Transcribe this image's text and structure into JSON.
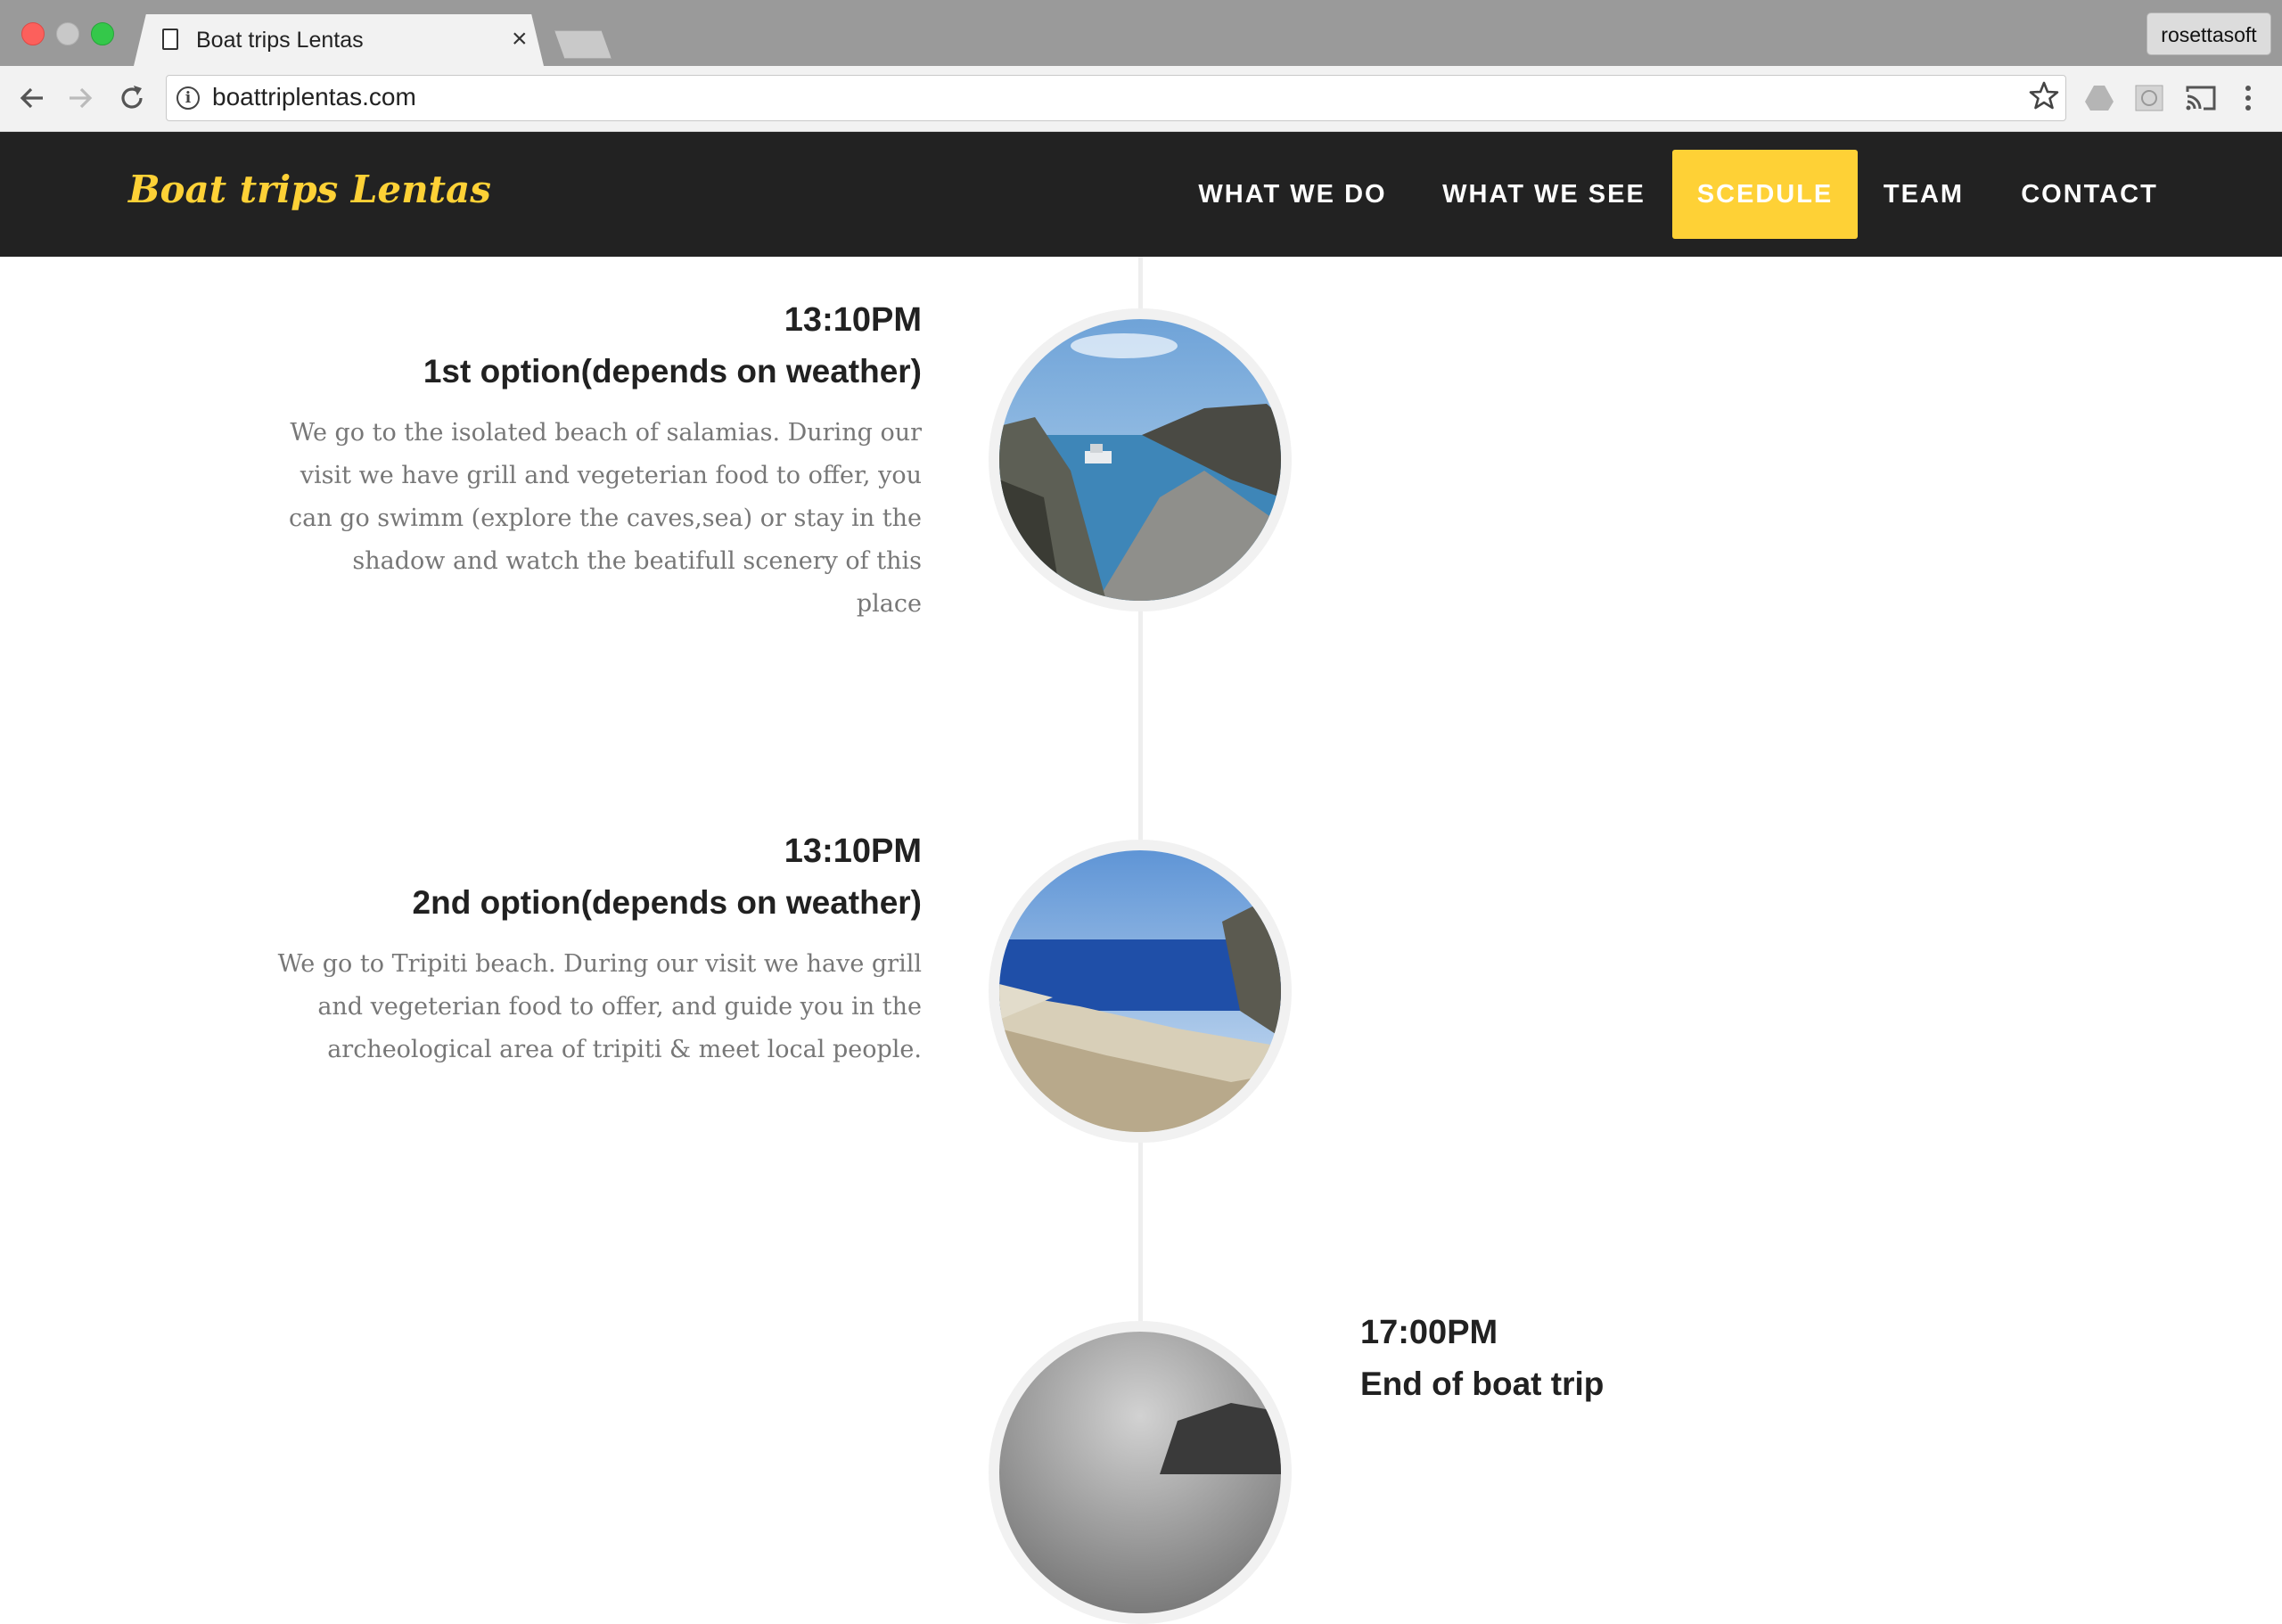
{
  "browser": {
    "tab_title": "Boat trips Lentas",
    "tab_close": "×",
    "profile_name": "rosettasoft",
    "url": "boattriplentas.com",
    "info_glyph": "i"
  },
  "site": {
    "brand": "Boat trips Lentas",
    "nav": [
      {
        "label": "WHAT WE DO",
        "active": false
      },
      {
        "label": "WHAT WE SEE",
        "active": false
      },
      {
        "label": "SCEDULE",
        "active": true
      },
      {
        "label": "TEAM",
        "active": false
      },
      {
        "label": "CONTACT",
        "active": false
      }
    ],
    "accent_color": "#fed136"
  },
  "timeline": [
    {
      "time": "13:10PM",
      "title": "1st option(depends on weather)",
      "lines": [
        "We go to the isolated beach of salamias. During our",
        "visit we have grill and vegeterian food to offer, you",
        "can go swimm (explore the caves,sea) or stay in the",
        "shadow and watch the beatifull scenery of this",
        "place"
      ]
    },
    {
      "time": "13:10PM",
      "title": "2nd option(depends on weather)",
      "lines": [
        "We go to Tripiti beach. During our visit we have grill",
        "and vegeterian food to offer, and guide you in the",
        "archeological area of tripiti & meet local people."
      ]
    },
    {
      "time": "17:00PM",
      "title": "End of boat trip",
      "lines": []
    }
  ]
}
